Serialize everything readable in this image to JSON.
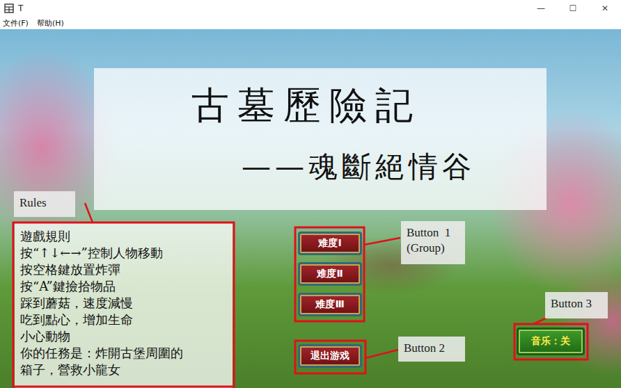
{
  "window": {
    "title": "T",
    "controls": [
      "—",
      "☐",
      "✕"
    ]
  },
  "menu": [
    "文件(F)",
    "帮助(H)"
  ],
  "game": {
    "title": "古墓歷險記",
    "subtitle": "——魂斷絕情谷",
    "rules": {
      "heading": "遊戲規則",
      "lines": [
        "按“↑↓←→”控制人物移動",
        "按空格鍵放置炸彈",
        "按“A”鍵撿拾物品",
        "踩到蘑菇，速度減慢",
        "吃到點心，增加生命",
        "小心動物",
        "你的任務是：炸開古堡周圍的",
        "箱子，營救小龍女"
      ]
    },
    "difficulty_buttons": [
      {
        "label": "难度Ⅰ"
      },
      {
        "label": "难度Ⅱ"
      },
      {
        "label": "难度Ⅲ"
      }
    ],
    "exit_button": {
      "label": "退出游戏"
    },
    "music_button": {
      "label": "音乐：关"
    }
  },
  "annotations": [
    {
      "kind": "rules",
      "lines": [
        "Rules"
      ]
    },
    {
      "kind": "group",
      "lines": [
        "Button  1",
        "(Group)"
      ]
    },
    {
      "kind": "exit",
      "lines": [
        "Button 2"
      ]
    },
    {
      "kind": "music",
      "lines": [
        "Button 3"
      ]
    }
  ]
}
